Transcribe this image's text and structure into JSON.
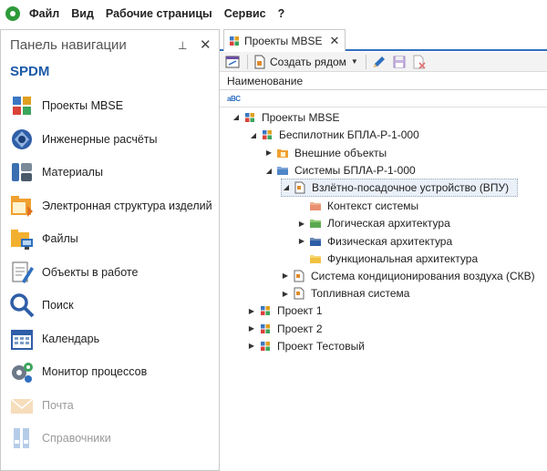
{
  "menu": {
    "items": [
      "Файл",
      "Вид",
      "Рабочие страницы",
      "Сервис",
      "?"
    ]
  },
  "nav": {
    "title": "Панель навигации",
    "pin_glyph": "⊥",
    "close_glyph": "✕",
    "brand": "SPDM",
    "items": [
      {
        "label": "Проекты MBSE",
        "icon": "mbse-grid-icon"
      },
      {
        "label": "Инженерные расчёты",
        "icon": "engineering-calc-icon"
      },
      {
        "label": "Материалы",
        "icon": "materials-icon"
      },
      {
        "label": "Электронная структура изделий",
        "icon": "product-structure-icon"
      },
      {
        "label": "Файлы",
        "icon": "files-icon"
      },
      {
        "label": "Объекты в работе",
        "icon": "objects-in-work-icon"
      },
      {
        "label": "Поиск",
        "icon": "search-icon"
      },
      {
        "label": "Календарь",
        "icon": "calendar-icon"
      },
      {
        "label": "Монитор процессов",
        "icon": "process-monitor-icon"
      },
      {
        "label": "Почта",
        "icon": "mail-icon"
      },
      {
        "label": "Справочники",
        "icon": "reference-books-icon"
      }
    ]
  },
  "tab": {
    "label": "Проекты MBSE",
    "close_glyph": "✕"
  },
  "toolbar": {
    "create_label": "Создать рядом"
  },
  "grid": {
    "column_header": "Наименование",
    "filter_icon_text": "aBC"
  },
  "tree": [
    {
      "label": "Проекты MBSE",
      "icon": "mbse-grid-icon",
      "state": "expanded"
    },
    {
      "label": "Беспилотник БПЛА-Р-1-000",
      "icon": "mbse-grid-icon",
      "state": "expanded"
    },
    {
      "label": "Внешние объекты",
      "icon": "folder-orange-icon",
      "state": "collapsed"
    },
    {
      "label": "Системы БПЛА-Р-1-000",
      "icon": "folder-blue-icon",
      "state": "expanded"
    },
    {
      "label": "Взлётно-посадочное устройство (ВПУ)",
      "icon": "system-doc-icon",
      "state": "expanded",
      "selected": true
    },
    {
      "label": "Контекст системы",
      "icon": "folder-salmon-icon",
      "state": "leaf"
    },
    {
      "label": "Логическая архитектура",
      "icon": "folder-green-icon",
      "state": "collapsed"
    },
    {
      "label": "Физическая архитектура",
      "icon": "folder-navy-icon",
      "state": "collapsed"
    },
    {
      "label": "Функциональная архитектура",
      "icon": "folder-yellow-icon",
      "state": "leaf"
    },
    {
      "label": "Система кондиционирования воздуха (СКВ)",
      "icon": "system-doc-icon",
      "state": "collapsed"
    },
    {
      "label": "Топливная система",
      "icon": "system-doc-icon",
      "state": "collapsed"
    },
    {
      "label": "Проект 1",
      "icon": "mbse-grid-icon",
      "state": "collapsed"
    },
    {
      "label": "Проект 2",
      "icon": "mbse-grid-icon",
      "state": "collapsed"
    },
    {
      "label": "Проект Тестовый",
      "icon": "mbse-grid-icon",
      "state": "collapsed"
    }
  ],
  "colors": {
    "accent": "#2f6fbf",
    "brand": "#1b5aa8",
    "selection": "#eaf0f8"
  }
}
